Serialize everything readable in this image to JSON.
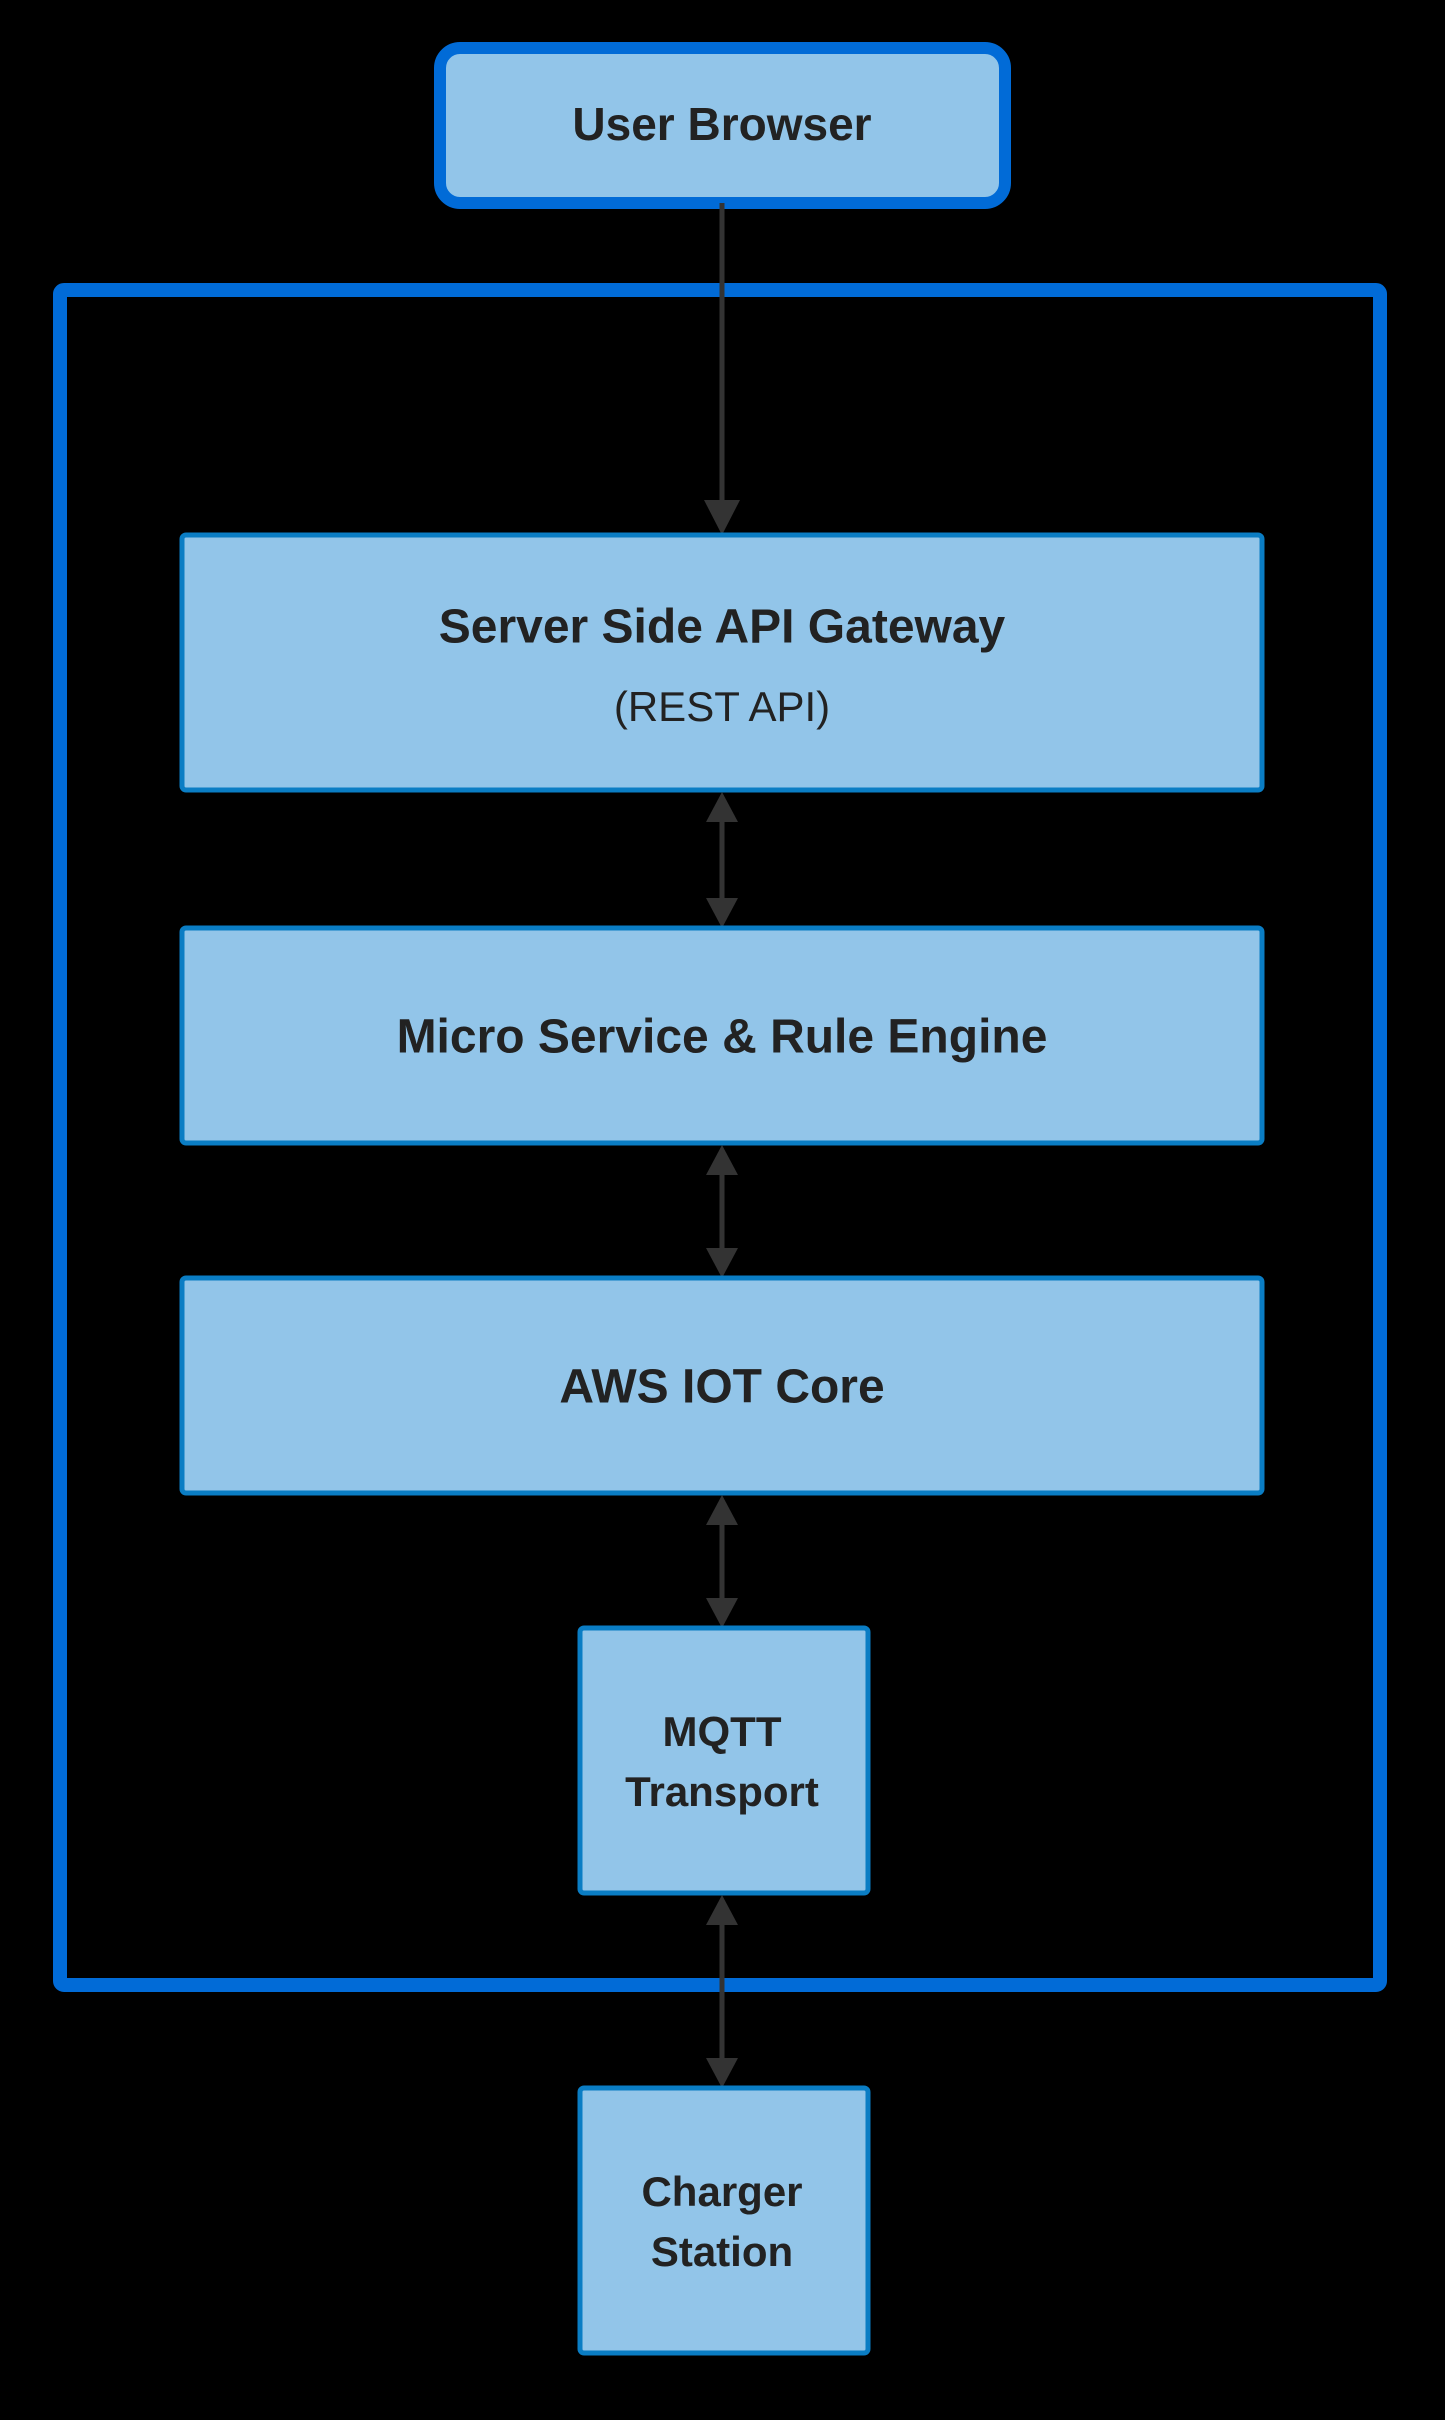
{
  "nodes": {
    "user_browser": {
      "label": "User Browser"
    },
    "api_gateway": {
      "title": "Server Side API Gateway",
      "subtitle": "(REST API)"
    },
    "micro_service": {
      "label": "Micro Service & Rule Engine"
    },
    "iot_core": {
      "label": "AWS IOT Core"
    },
    "mqtt": {
      "line1": "MQTT",
      "line2": "Transport"
    },
    "charger": {
      "line1": "Charger",
      "line2": "Station"
    }
  }
}
